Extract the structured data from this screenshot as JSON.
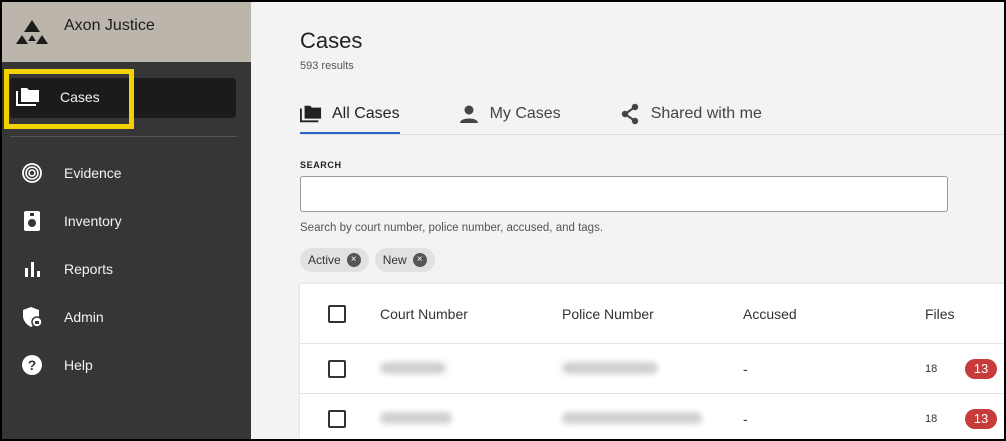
{
  "app": {
    "name": "Axon Justice",
    "logo_icon": "axon-logo-icon"
  },
  "sidebar": {
    "active_item": {
      "label": "Cases",
      "icon": "folder-icon"
    },
    "items": [
      {
        "label": "Evidence",
        "icon": "fingerprint-icon"
      },
      {
        "label": "Inventory",
        "icon": "locker-icon"
      },
      {
        "label": "Reports",
        "icon": "bar-chart-icon"
      },
      {
        "label": "Admin",
        "icon": "shield-icon"
      },
      {
        "label": "Help",
        "icon": "help-icon"
      }
    ],
    "highlight_color": "#f2d300"
  },
  "main": {
    "title": "Cases",
    "results": "593 results",
    "tabs": [
      {
        "label": "All Cases",
        "icon": "folder-icon",
        "active": true
      },
      {
        "label": "My Cases",
        "icon": "person-icon",
        "active": false
      },
      {
        "label": "Shared with me",
        "icon": "share-icon",
        "active": false
      }
    ],
    "search": {
      "label": "SEARCH",
      "value": "",
      "placeholder": "",
      "help": "Search by court number, police number, accused, and tags."
    },
    "filters": [
      {
        "label": "Active"
      },
      {
        "label": "New"
      }
    ],
    "table": {
      "columns": [
        "Court Number",
        "Police Number",
        "Accused",
        "Files"
      ],
      "rows": [
        {
          "accused": "-",
          "files": "18",
          "badge": "13"
        },
        {
          "accused": "-",
          "files": "18",
          "badge": "13"
        }
      ]
    }
  },
  "colors": {
    "accent": "#2d63c8",
    "badge": "#c73b3b",
    "sidebar": "#363636"
  }
}
